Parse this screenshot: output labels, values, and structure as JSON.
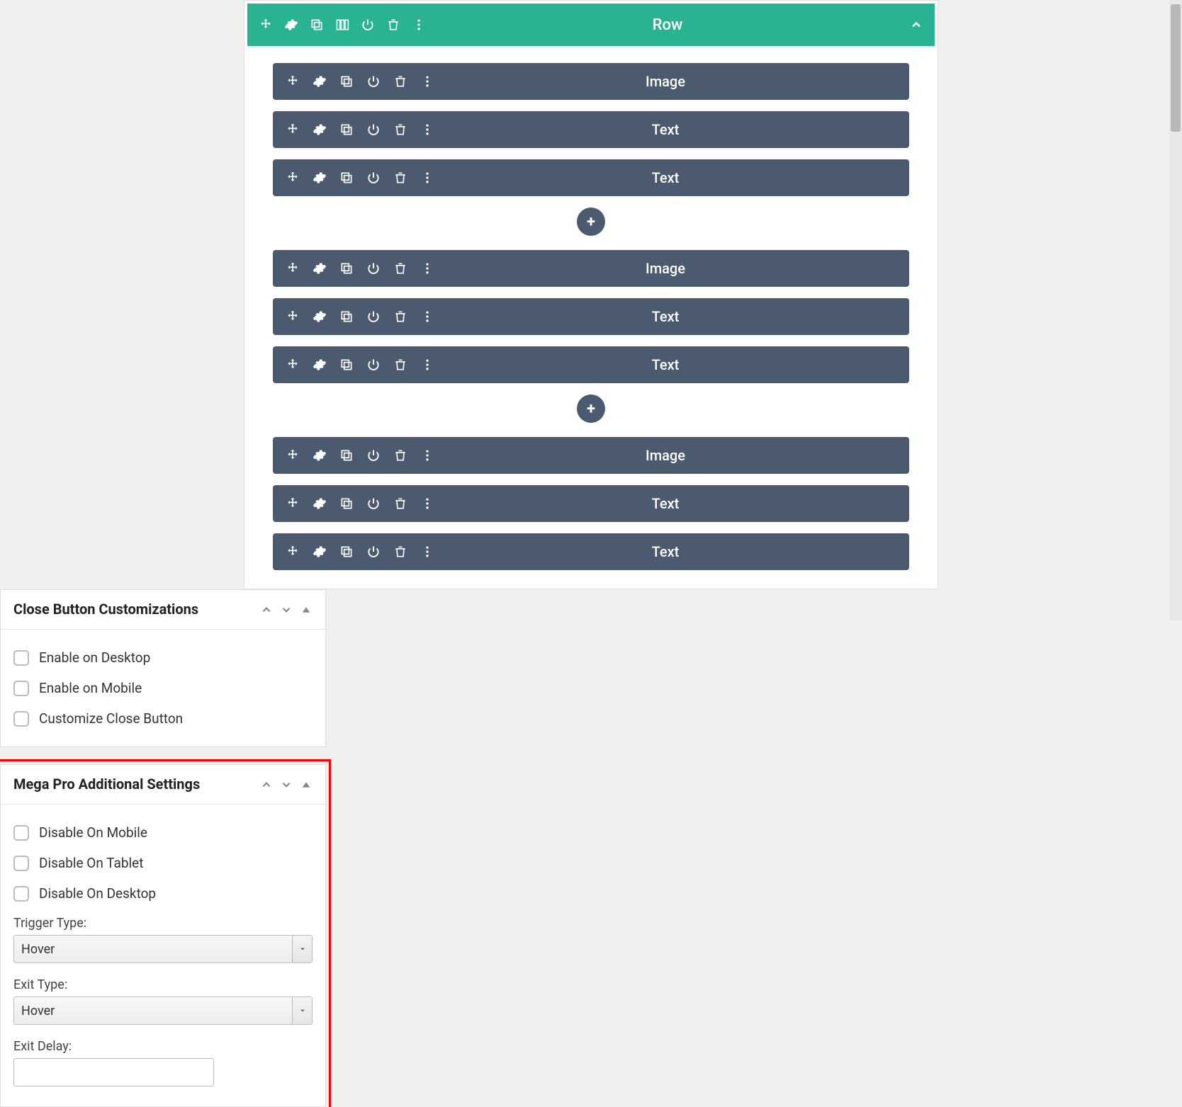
{
  "builder": {
    "row": {
      "title": "Row"
    },
    "groups": [
      {
        "modules": [
          {
            "label": "Image"
          },
          {
            "label": "Text"
          },
          {
            "label": "Text"
          }
        ]
      },
      {
        "modules": [
          {
            "label": "Image"
          },
          {
            "label": "Text"
          },
          {
            "label": "Text"
          }
        ]
      },
      {
        "modules": [
          {
            "label": "Image"
          },
          {
            "label": "Text"
          },
          {
            "label": "Text"
          }
        ]
      }
    ]
  },
  "sidebar": {
    "panel_close": {
      "title": "Close Button Customizations",
      "opts": [
        {
          "label": "Enable on Desktop"
        },
        {
          "label": "Enable on Mobile"
        },
        {
          "label": "Customize Close Button"
        }
      ]
    },
    "panel_mega": {
      "title": "Mega Pro Additional Settings",
      "opts": [
        {
          "label": "Disable On Mobile"
        },
        {
          "label": "Disable On Tablet"
        },
        {
          "label": "Disable On Desktop"
        }
      ],
      "trigger_label": "Trigger Type:",
      "trigger_value": "Hover",
      "exit_label": "Exit Type:",
      "exit_value": "Hover",
      "exit_delay_label": "Exit Delay:",
      "exit_delay_value": ""
    }
  }
}
